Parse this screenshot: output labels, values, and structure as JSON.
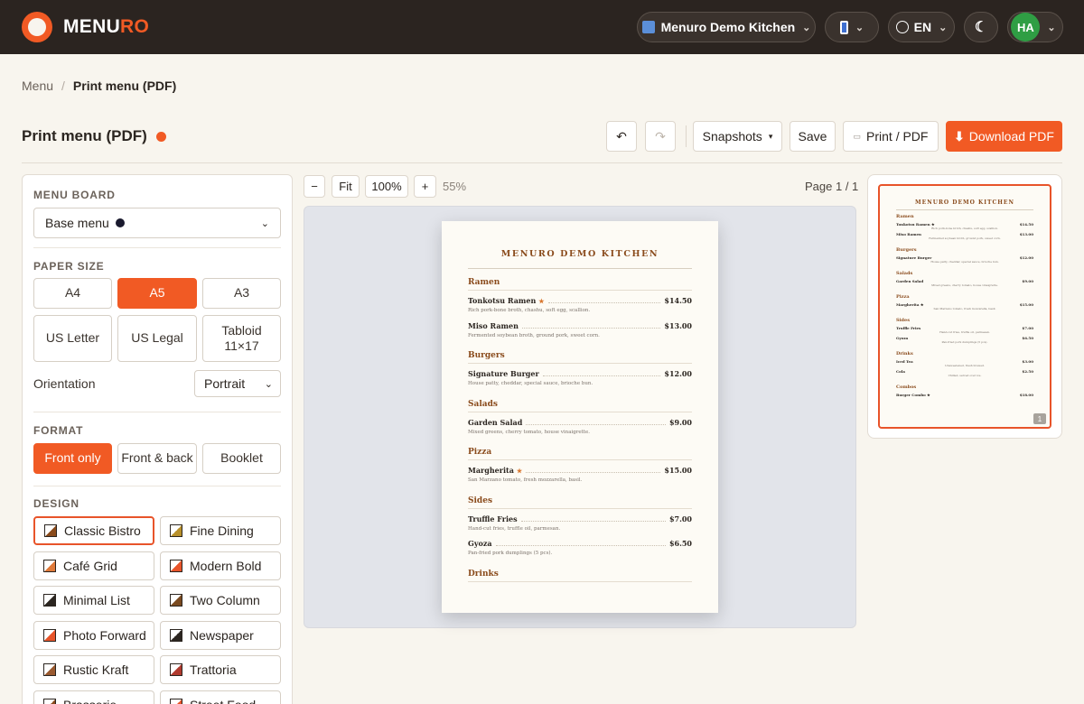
{
  "brand": {
    "name_prefix": "MENU",
    "name_accent": "RO",
    "accent_color": "#f15a24",
    "bar_color": "#2b2420"
  },
  "topbar": {
    "restaurant": "Menuro Demo Kitchen",
    "language": "EN",
    "avatar_initials": "HA"
  },
  "breadcrumb": {
    "parent": "Menu",
    "separator": "/",
    "current": "Print menu (PDF)"
  },
  "header": {
    "title": "Print menu (PDF)",
    "snapshots": "Snapshots",
    "save": "Save",
    "print": "Print / PDF",
    "download": "Download PDF"
  },
  "panel": {
    "menu_board_label": "MENU BOARD",
    "menu_board_value": "Base menu",
    "paper_size_label": "PAPER SIZE",
    "paper_sizes": [
      "A4",
      "A5",
      "A3",
      "US Letter",
      "US Legal",
      "Tabloid 11×17"
    ],
    "paper_selected": "A5",
    "orientation_label": "Orientation",
    "orientation_value": "Portrait",
    "format_label": "FORMAT",
    "formats": [
      "Front only",
      "Front & back",
      "Booklet"
    ],
    "format_selected": "Front only",
    "design_label": "DESIGN",
    "designs": [
      {
        "name": "Classic Bistro",
        "color": "#8a4b1c"
      },
      {
        "name": "Fine Dining",
        "color": "#b8902a"
      },
      {
        "name": "Café Grid",
        "color": "#e07a3a"
      },
      {
        "name": "Modern Bold",
        "color": "#e8542a"
      },
      {
        "name": "Minimal List",
        "color": "#2b2520"
      },
      {
        "name": "Two Column",
        "color": "#7a4a20"
      },
      {
        "name": "Photo Forward",
        "color": "#e8542a"
      },
      {
        "name": "Newspaper",
        "color": "#2b2520"
      },
      {
        "name": "Rustic Kraft",
        "color": "#9a5a30"
      },
      {
        "name": "Trattoria",
        "color": "#b03a2e"
      },
      {
        "name": "Brasserie",
        "color": "#8a4b1c"
      },
      {
        "name": "Street Food",
        "color": "#e8542a"
      }
    ],
    "design_selected": "Classic Bistro"
  },
  "zoom": {
    "minus": "−",
    "fit": "Fit",
    "reset": "100%",
    "plus": "+",
    "level": "55%",
    "page_indicator": "Page 1 / 1"
  },
  "sheet": {
    "title": "MENURO DEMO KITCHEN",
    "sections": [
      {
        "name": "Ramen",
        "items": [
          {
            "name": "Tonkotsu Ramen",
            "star": true,
            "price": "$14.50",
            "desc": "Rich pork-bone broth, chashu, soft egg, scallion."
          },
          {
            "name": "Miso Ramen",
            "star": false,
            "price": "$13.00",
            "desc": "Fermented soybean broth, ground pork, sweet corn."
          }
        ]
      },
      {
        "name": "Burgers",
        "items": [
          {
            "name": "Signature Burger",
            "star": false,
            "price": "$12.00",
            "desc": "House patty, cheddar, special sauce, brioche bun."
          }
        ]
      },
      {
        "name": "Salads",
        "items": [
          {
            "name": "Garden Salad",
            "star": false,
            "price": "$9.00",
            "desc": "Mixed greens, cherry tomato, house vinaigrette."
          }
        ]
      },
      {
        "name": "Pizza",
        "items": [
          {
            "name": "Margherita",
            "star": true,
            "price": "$15.00",
            "desc": "San Marzano tomato, fresh mozzarella, basil."
          }
        ]
      },
      {
        "name": "Sides",
        "items": [
          {
            "name": "Truffle Fries",
            "star": false,
            "price": "$7.00",
            "desc": "Hand-cut fries, truffle oil, parmesan."
          },
          {
            "name": "Gyoza",
            "star": false,
            "price": "$6.50",
            "desc": "Pan-fried pork dumplings (5 pcs)."
          }
        ]
      },
      {
        "name": "Drinks",
        "items": []
      }
    ]
  },
  "thumbnail": {
    "title": "MENURO DEMO KITCHEN",
    "sections": [
      {
        "name": "Ramen",
        "items": [
          {
            "name": "Tonkotsu Ramen ★",
            "price": "$14.50",
            "desc": "Rich pork-bone broth, chashu, soft egg, scallion."
          },
          {
            "name": "Miso Ramen",
            "price": "$13.00",
            "desc": "Fermented soybean broth, ground pork, sweet corn."
          }
        ]
      },
      {
        "name": "Burgers",
        "items": [
          {
            "name": "Signature Burger",
            "price": "$12.00",
            "desc": "House patty, cheddar, special sauce, brioche bun."
          }
        ]
      },
      {
        "name": "Salads",
        "items": [
          {
            "name": "Garden Salad",
            "price": "$9.00",
            "desc": "Mixed greens, cherry tomato, house vinaigrette."
          }
        ]
      },
      {
        "name": "Pizza",
        "items": [
          {
            "name": "Margherita ★",
            "price": "$15.00",
            "desc": "San Marzano tomato, fresh mozzarella, basil."
          }
        ]
      },
      {
        "name": "Sides",
        "items": [
          {
            "name": "Truffle Fries",
            "price": "$7.00",
            "desc": "Hand-cut fries, truffle oil, parmesan."
          },
          {
            "name": "Gyoza",
            "price": "$6.50",
            "desc": "Pan-fried pork dumplings (5 pcs)."
          }
        ]
      },
      {
        "name": "Drinks",
        "items": [
          {
            "name": "Iced Tea",
            "price": "$3.00",
            "desc": "Unsweetened, fresh brewed."
          },
          {
            "name": "Cola",
            "price": "$2.50",
            "desc": "Chilled, served over ice."
          }
        ]
      },
      {
        "name": "Combos",
        "items": [
          {
            "name": "Burger Combo ★",
            "price": "$18.00",
            "desc": ""
          }
        ]
      }
    ],
    "page_badge": "1"
  }
}
